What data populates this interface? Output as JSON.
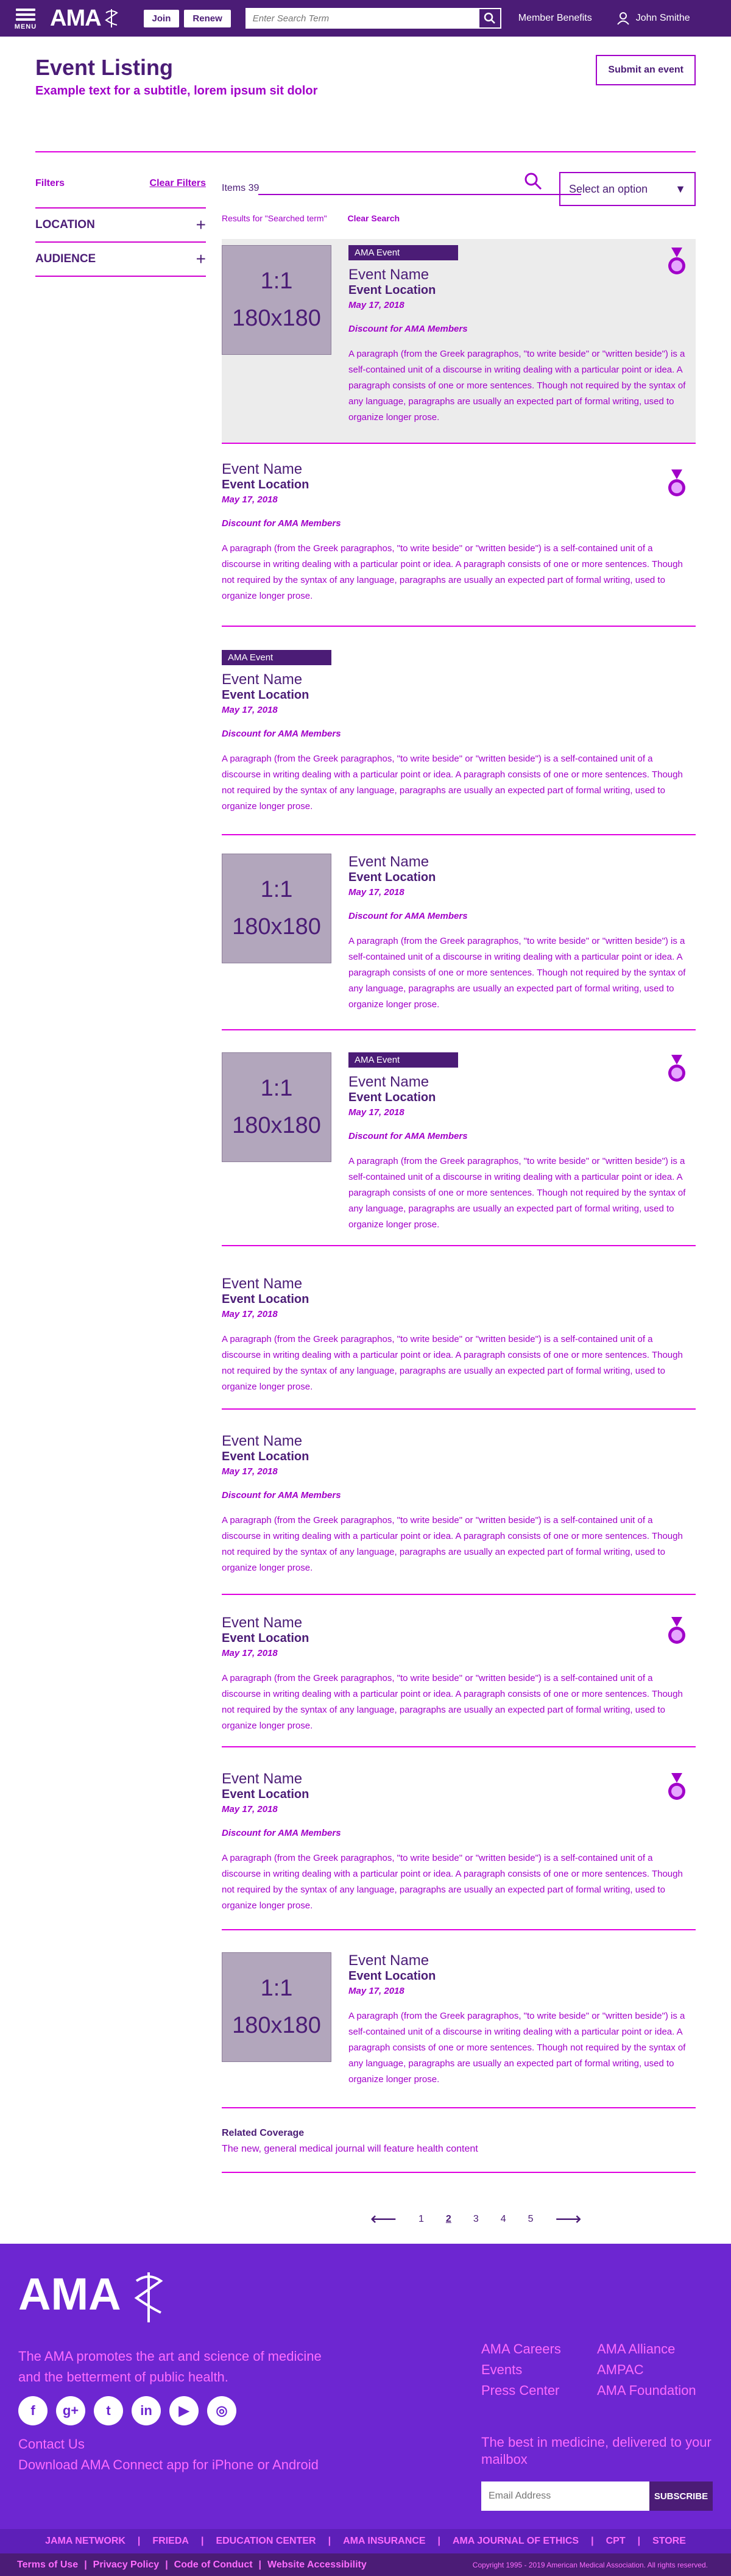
{
  "header": {
    "menu_label": "MENU",
    "logo": "AMA",
    "join": "Join",
    "renew": "Renew",
    "search_placeholder": "Enter Search Term",
    "member_benefits": "Member Benefits",
    "user": "John Smithe"
  },
  "page": {
    "title": "Event Listing",
    "subtitle": "Example text for a subtitle, lorem ipsum sit dolor",
    "submit": "Submit an event"
  },
  "filters": {
    "label": "Filters",
    "clear": "Clear Filters",
    "facets": [
      "LOCATION",
      "AUDIENCE"
    ]
  },
  "toolbar": {
    "items": "Items 39",
    "select": "Select an option",
    "results": "Results for \"Searched term\"",
    "clear_search": "Clear Search"
  },
  "event": {
    "badge": "AMA Event",
    "name": "Event Name",
    "location": "Event Location",
    "date": "May 17, 2018",
    "discount": "Discount for AMA Members",
    "paragraph": "A paragraph (from the Greek paragraphos, \"to write beside\" or \"written beside\") is a self-contained unit of a discourse in writing dealing with a particular point or idea. A paragraph consists of one or more sentences. Though not required by the syntax of any language, paragraphs are usually an expected part of formal writing, used to organize longer prose.",
    "thumb_ratio": "1:1",
    "thumb_size": "180x180"
  },
  "related": {
    "title": "Related Coverage",
    "link": "The new, general medical journal will feature health content"
  },
  "pager": {
    "pages": [
      "1",
      "2",
      "3",
      "4",
      "5"
    ]
  },
  "footer": {
    "logo": "AMA",
    "tagline": "The AMA promotes the art and science of medicine and the betterment of public health.",
    "contact": "Contact Us",
    "download": "Download AMA Connect app for iPhone or Android",
    "links": [
      "AMA Careers",
      "AMA Alliance",
      "Events",
      "AMPAC",
      "Press Center",
      "AMA Foundation"
    ],
    "best": "The best in medicine, delivered to your mailbox",
    "email_placeholder": "Email Address",
    "subscribe": "SUBSCRIBE",
    "nav": [
      "JAMA NETWORK",
      "|",
      "FRIEDA",
      "|",
      "EDUCATION CENTER",
      "|",
      "AMA INSURANCE",
      "|",
      "AMA JOURNAL OF ETHICS",
      "|",
      "CPT",
      "|",
      "STORE"
    ],
    "bottom": [
      "Terms of Use",
      "|",
      "Privacy Policy",
      "|",
      "Code of Conduct",
      "|",
      "Website Accessibility"
    ],
    "copyright": "Copyright 1995 - 2019 American Medical Association. All rights reserved."
  }
}
